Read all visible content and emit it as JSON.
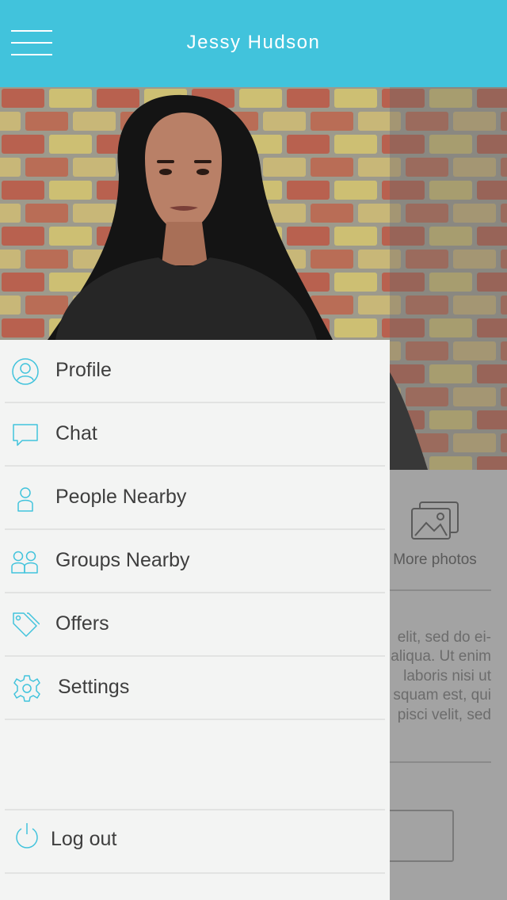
{
  "header": {
    "title": "Jessy Hudson",
    "menu_icon": "hamburger-icon",
    "background_color": "#41c3dc"
  },
  "drawer": {
    "items": [
      {
        "label": "Profile",
        "icon": "user-circle-icon"
      },
      {
        "label": "Chat",
        "icon": "chat-bubble-icon"
      },
      {
        "label": "People Nearby",
        "icon": "person-icon"
      },
      {
        "label": "Groups Nearby",
        "icon": "group-icon"
      },
      {
        "label": "Offers",
        "icon": "tags-icon"
      },
      {
        "label": "Settings",
        "icon": "gear-icon"
      }
    ],
    "logout": {
      "label": "Log out",
      "icon": "power-icon"
    },
    "accent_color": "#41c3dc"
  },
  "background_page": {
    "more_photos_label": "More photos",
    "text_lines": [
      "elit, sed do ei-",
      "aliqua. Ut enim",
      "laboris nisi ut",
      "squam est, qui",
      "pisci velit, sed"
    ]
  }
}
